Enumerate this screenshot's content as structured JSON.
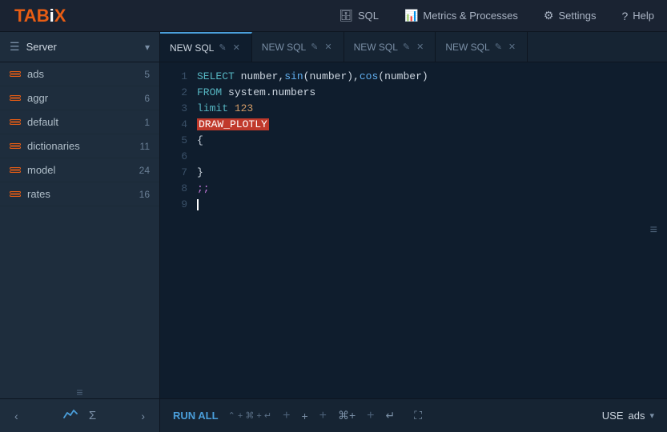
{
  "app": {
    "logo_text": "TABiX"
  },
  "topnav": {
    "sql_icon": "🗄",
    "sql_label": "SQL",
    "metrics_icon": "📊",
    "metrics_label": "Metrics & Processes",
    "settings_icon": "⚙",
    "settings_label": "Settings",
    "help_icon": "?",
    "help_label": "Help"
  },
  "sidebar": {
    "title": "Server",
    "items": [
      {
        "name": "ads",
        "count": "5"
      },
      {
        "name": "aggr",
        "count": "6"
      },
      {
        "name": "default",
        "count": "1"
      },
      {
        "name": "dictionaries",
        "count": "11"
      },
      {
        "name": "model",
        "count": "24"
      },
      {
        "name": "rates",
        "count": "16"
      }
    ],
    "footer_separator": "≡",
    "chart_icon": "📈",
    "sigma_icon": "Σ",
    "prev_icon": "‹",
    "next_icon": "›"
  },
  "tabs": [
    {
      "label": "NEW SQL",
      "active": true,
      "closable": true
    },
    {
      "label": "NEW SQL",
      "active": false,
      "closable": true
    },
    {
      "label": "NEW SQL",
      "active": false,
      "closable": true
    },
    {
      "label": "NEW SQL",
      "active": false,
      "closable": true
    }
  ],
  "editor": {
    "lines": [
      {
        "num": "1",
        "content_html": "<span class='kw-select'>SELECT</span> number,<span class='fn-sin'>sin</span>(number),<span class='fn-cos'>cos</span>(number)"
      },
      {
        "num": "2",
        "content_html": "<span class='kw-from'>FROM</span> system.numbers"
      },
      {
        "num": "3",
        "content_html": "<span class='kw-limit'>limit</span> <span class='num-val'>123</span>"
      },
      {
        "num": "4",
        "content_html": "<span class='kw-draw'>DRAW_PLOTLY</span>"
      },
      {
        "num": "5",
        "content_html": "<span class='brace'>{</span>"
      },
      {
        "num": "6",
        "content_html": ""
      },
      {
        "num": "7",
        "content_html": "<span class='brace'>}</span>"
      },
      {
        "num": "8",
        "content_html": "<span class='semicolon'>;;</span>"
      },
      {
        "num": "9",
        "content_html": "",
        "cursor": true
      }
    ]
  },
  "bottom_bar": {
    "run_all_label": "RUN ALL",
    "shortcut_label": "⌃ + ⌘ + ↵",
    "use_label": "USE",
    "db_name": "ads"
  }
}
